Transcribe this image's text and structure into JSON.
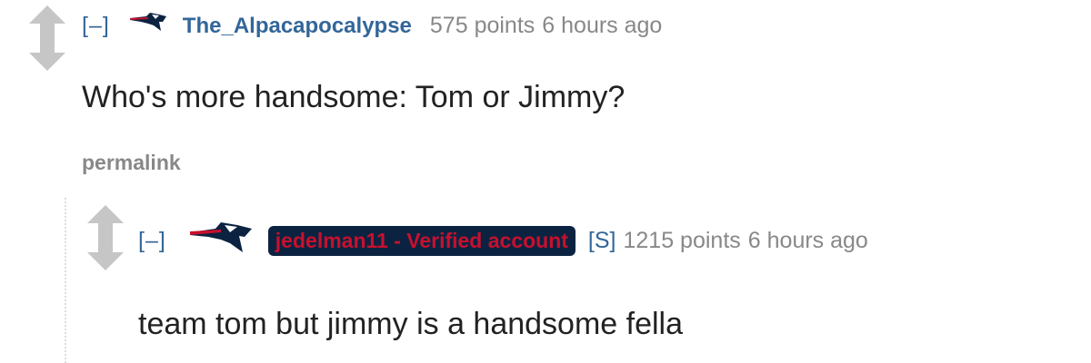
{
  "thread": {
    "parent": {
      "collapse_label": "[–]",
      "flair_icon": "patriots-logo-icon",
      "author": "The_Alpacapocalypse",
      "points": "575 points",
      "time": "6 hours ago",
      "body": "Who's more handsome: Tom or Jimmy?",
      "permalink": "permalink"
    },
    "reply": {
      "collapse_label": "[–]",
      "flair_icon": "patriots-logo-icon",
      "author_badge": "jedelman11 - Verified account",
      "submitter_tag": "[S]",
      "points": "1215 points",
      "time": "6 hours ago",
      "body": "team tom but jimmy is a handsome fella"
    }
  },
  "colors": {
    "link_blue": "#336699",
    "meta_gray": "#888888",
    "badge_navy": "#0b2341",
    "badge_red": "#c8102e",
    "arrow_gray": "#c6c6c6"
  }
}
